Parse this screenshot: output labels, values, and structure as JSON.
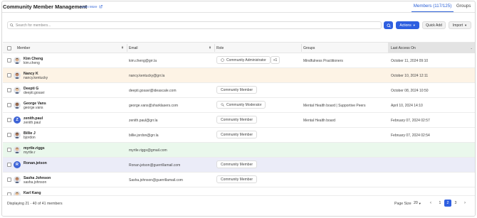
{
  "header": {
    "title": "Community Member Management",
    "learn_more": "Learn More",
    "tabs": [
      {
        "label": "Members (117/125)",
        "active": true
      },
      {
        "label": "Groups",
        "active": false
      }
    ]
  },
  "toolbar": {
    "search_placeholder": "Search for members...",
    "actions_label": "Actions",
    "quick_add_label": "Quick Add",
    "import_label": "Import",
    "accent_color": "#2f5fe0"
  },
  "table": {
    "columns": {
      "member": "Member",
      "email": "Email",
      "role": "Role",
      "groups": "Groups",
      "last_access": "Last Access On"
    },
    "rows": [
      {
        "name": "Kim Cheng",
        "username": "kim.cheng",
        "email": "kim.cheng@grr.la",
        "role": "Community Administrator",
        "role_icon": "admin-icon",
        "role_more": "+1",
        "groups": "Mindfulness Practitioners",
        "last_access": "October 11, 2024 09:10",
        "avatar": "photo",
        "highlight": ""
      },
      {
        "name": "Nancy K",
        "username": "nancy.kentucky",
        "email": "nancy.kentucky@grr.la",
        "role": "",
        "role_icon": "",
        "role_more": "",
        "groups": "",
        "last_access": "October 10, 2024 12:11",
        "avatar": "photo",
        "highlight": "orange"
      },
      {
        "name": "Deepti G",
        "username": "deepti.gosavi",
        "email": "deepti.gosavi@ideascale.com",
        "role": "Community Member",
        "role_icon": "",
        "role_more": "",
        "groups": "",
        "last_access": "October 08, 2024 10:50",
        "avatar": "photo",
        "highlight": ""
      },
      {
        "name": "George Vans",
        "username": "george.vans",
        "email": "george.vans@sharklasers.com",
        "role": "Community Moderator",
        "role_icon": "moderator-icon",
        "role_more": "",
        "groups": "Mental Health board | Supportive Peers",
        "last_access": "April 10, 2024 14:10",
        "avatar": "photo",
        "highlight": ""
      },
      {
        "name": "zenith.paul",
        "username": "zenith.paul",
        "email": "zenith.paul@grr.la",
        "role": "Community Member",
        "role_icon": "",
        "role_more": "",
        "groups": "Mental Health board",
        "last_access": "February 07, 2024 02:57",
        "avatar": "Z",
        "highlight": ""
      },
      {
        "name": "Billie J",
        "username": "bjordon",
        "email": "billie.jordon@grr.la",
        "role": "Community Member",
        "role_icon": "",
        "role_more": "",
        "groups": "",
        "last_access": "February 07, 2024 02:54",
        "avatar": "photo",
        "highlight": ""
      },
      {
        "name": "myrtle.riggs",
        "username": "myrtle.r",
        "email": "myrtle.riggs@gmail.com",
        "role": "",
        "role_icon": "",
        "role_more": "",
        "groups": "",
        "last_access": "",
        "avatar": "photo",
        "highlight": "green"
      },
      {
        "name": "Ronan.jetson",
        "username": "",
        "email": "Ronan.jetson@guerrillamail.com",
        "role": "Community Member",
        "role_icon": "",
        "role_more": "",
        "groups": "",
        "last_access": "",
        "avatar": "R",
        "highlight": "blue"
      },
      {
        "name": "Sasha Johnson",
        "username": "sasha.johnson",
        "email": "Sasha.johnson@guerrillamail.com",
        "role": "Community Member",
        "role_icon": "",
        "role_more": "",
        "groups": "",
        "last_access": "",
        "avatar": "photo",
        "highlight": ""
      },
      {
        "name": "Karl Kang",
        "username": "",
        "email": "",
        "role": "",
        "role_icon": "",
        "role_more": "",
        "groups": "",
        "last_access": "",
        "avatar": "photo",
        "highlight": ""
      }
    ]
  },
  "footer": {
    "display_text": "Displaying 21 - 40 of 41 members",
    "page_size_label": "Page Size",
    "page_size_value": "20",
    "pages": [
      "1",
      "2",
      "3"
    ],
    "current_page": "2"
  }
}
